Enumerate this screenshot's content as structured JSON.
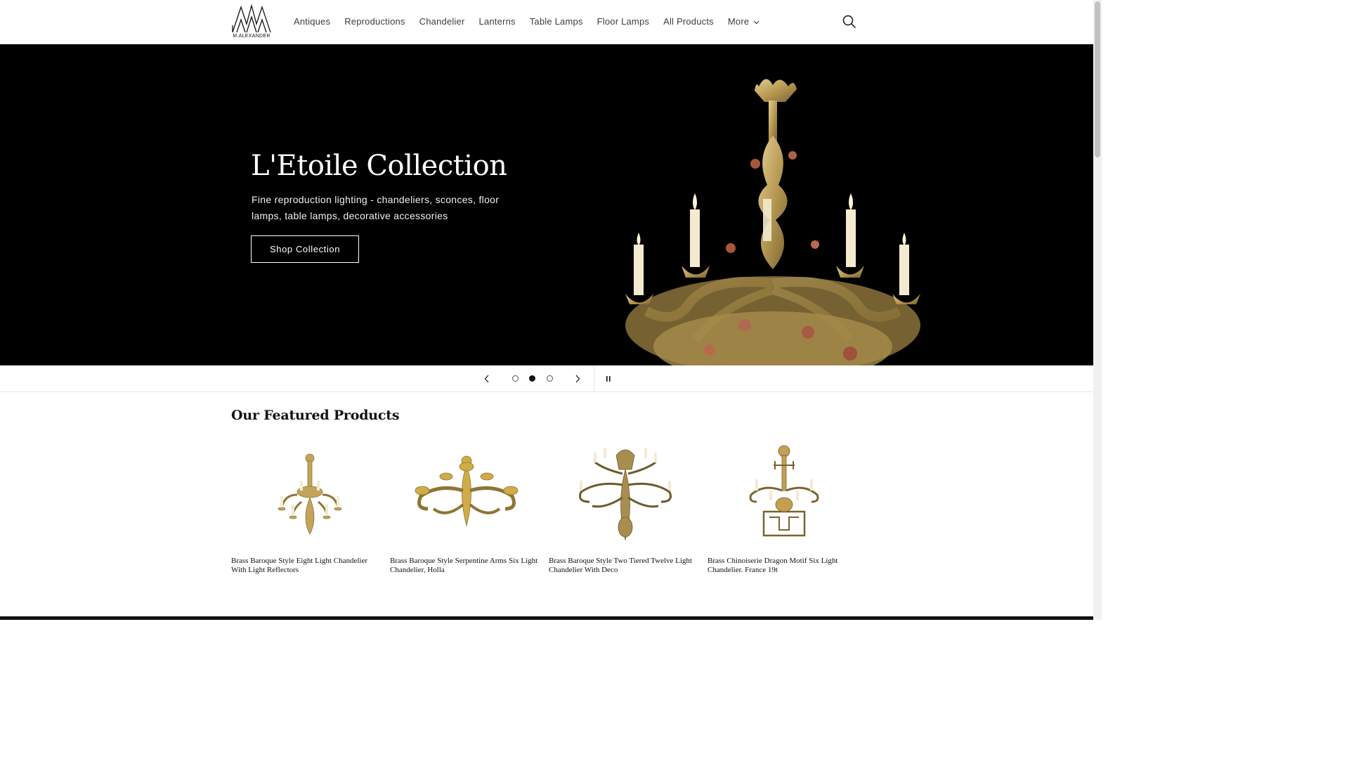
{
  "brand": {
    "logo_text": "M.ALEXANDER"
  },
  "nav": {
    "items": [
      {
        "label": "Antiques"
      },
      {
        "label": "Reproductions"
      },
      {
        "label": "Chandelier"
      },
      {
        "label": "Lanterns"
      },
      {
        "label": "Table Lamps"
      },
      {
        "label": "Floor Lamps"
      },
      {
        "label": "All Products"
      },
      {
        "label": "More"
      }
    ],
    "search_icon": "search-icon"
  },
  "hero": {
    "title": "L'Etoile Collection",
    "subtitle": "Fine reproduction lighting - chandeliers, sconces, floor lamps, table lamps, decorative accessories",
    "button_label": "Shop Collection"
  },
  "slider": {
    "slide_count": 3,
    "active_slide": 2,
    "prev_icon": "chevron-left-icon",
    "next_icon": "chevron-right-icon",
    "pause_icon": "pause-icon"
  },
  "featured": {
    "title": "Our Featured Products",
    "products": [
      {
        "name": "Brass Baroque Style Eight Light Chandelier With Light Reflectors"
      },
      {
        "name": "Brass Baroque Style Serpentine Arms Six Light Chandelier, Holla"
      },
      {
        "name": "Brass Baroque Style Two Tiered Twelve Light Chandelier With Deco"
      },
      {
        "name": "Brass Chinoiserie Dragon Motif Six Light Chandelier. France 19t"
      }
    ]
  },
  "colors": {
    "hero_bg": "#000000",
    "brass": "#b89a52",
    "text": "#121212"
  }
}
